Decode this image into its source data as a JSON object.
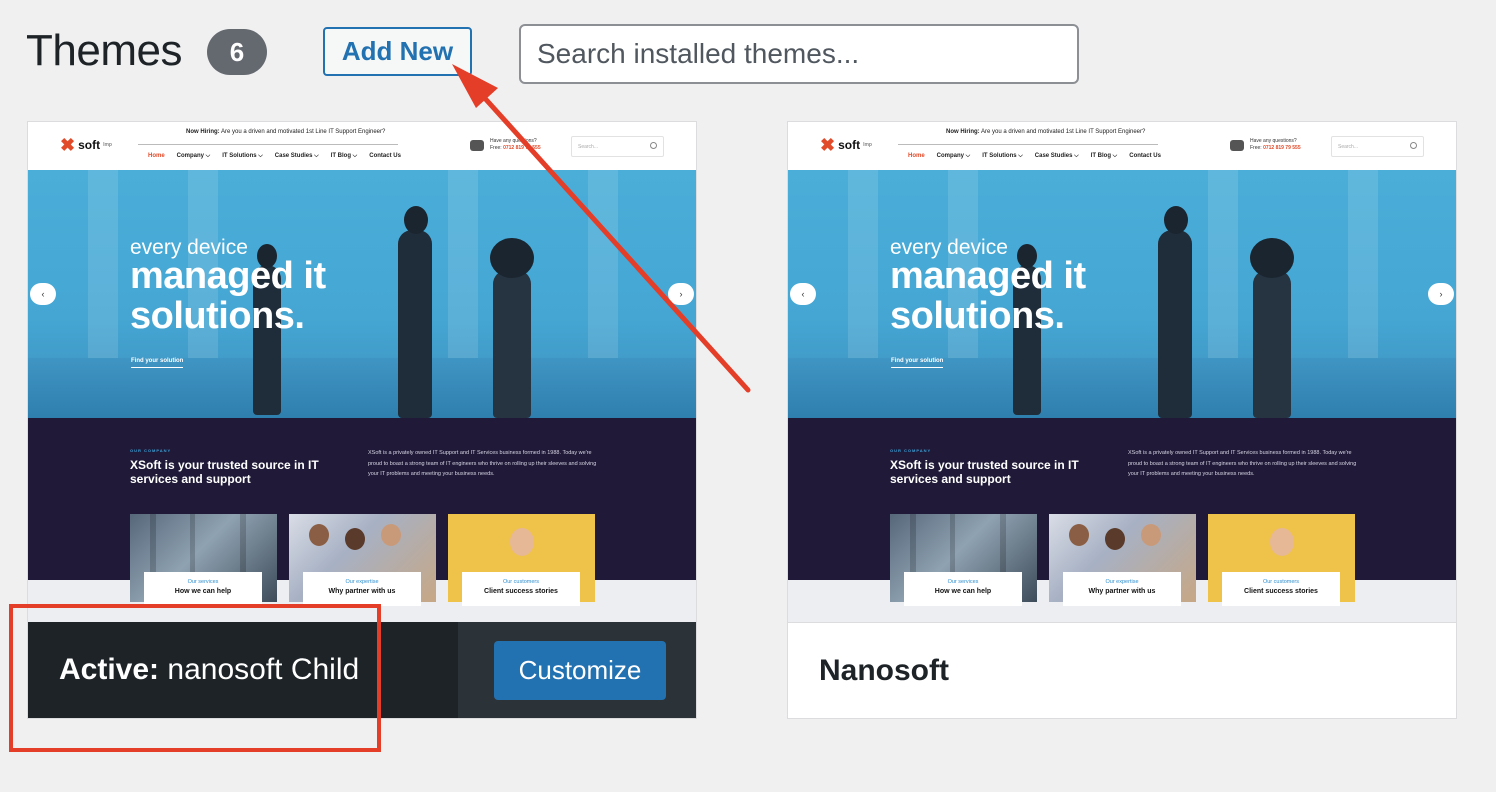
{
  "header": {
    "title": "Themes",
    "count": "6",
    "add_new_label": "Add New",
    "search_placeholder": "Search installed themes..."
  },
  "preview": {
    "logo_text": "soft",
    "logo_sup": "lmp",
    "hiring_bold": "Now Hiring:",
    "hiring_text": "Are you a driven and motivated 1st Line IT Support Engineer?",
    "menu": [
      "Home",
      "Company ⌵",
      "IT Solutions ⌵",
      "Case Studies ⌵",
      "IT Blog ⌵",
      "Contact Us"
    ],
    "contact_line1": "Have any questions?",
    "contact_line2_label": "Free:",
    "contact_line2_value": "0712 819 79 555",
    "search_placeholder": "Search...",
    "hero_small": "every device",
    "hero_big_line1": "managed it",
    "hero_big_line2": "solutions.",
    "hero_link": "Find your solution",
    "arrow_left": "‹",
    "arrow_right": "›",
    "eyebrow": "OUR COMPANY",
    "section_title": "XSoft is your trusted source in IT services and support",
    "section_text": "XSoft is a privately owned IT Support and IT Services business formed in 1988. Today we're proud to boast a strong team of IT engineers who thrive on rolling up their sleeves and solving your IT problems and meeting your business needs.",
    "tiles": [
      {
        "small": "Our services",
        "big": "How we can help"
      },
      {
        "small": "Our expertise",
        "big": "Why partner with us"
      },
      {
        "small": "Our customers",
        "big": "Client success stories"
      }
    ]
  },
  "themes": [
    {
      "active_prefix": "Active:",
      "name": "nanosoft Child",
      "customize_label": "Customize"
    },
    {
      "name": "Nanosoft"
    }
  ],
  "colors": {
    "accent": "#2271b1",
    "annotation": "#e43d28",
    "badge": "#646970"
  }
}
